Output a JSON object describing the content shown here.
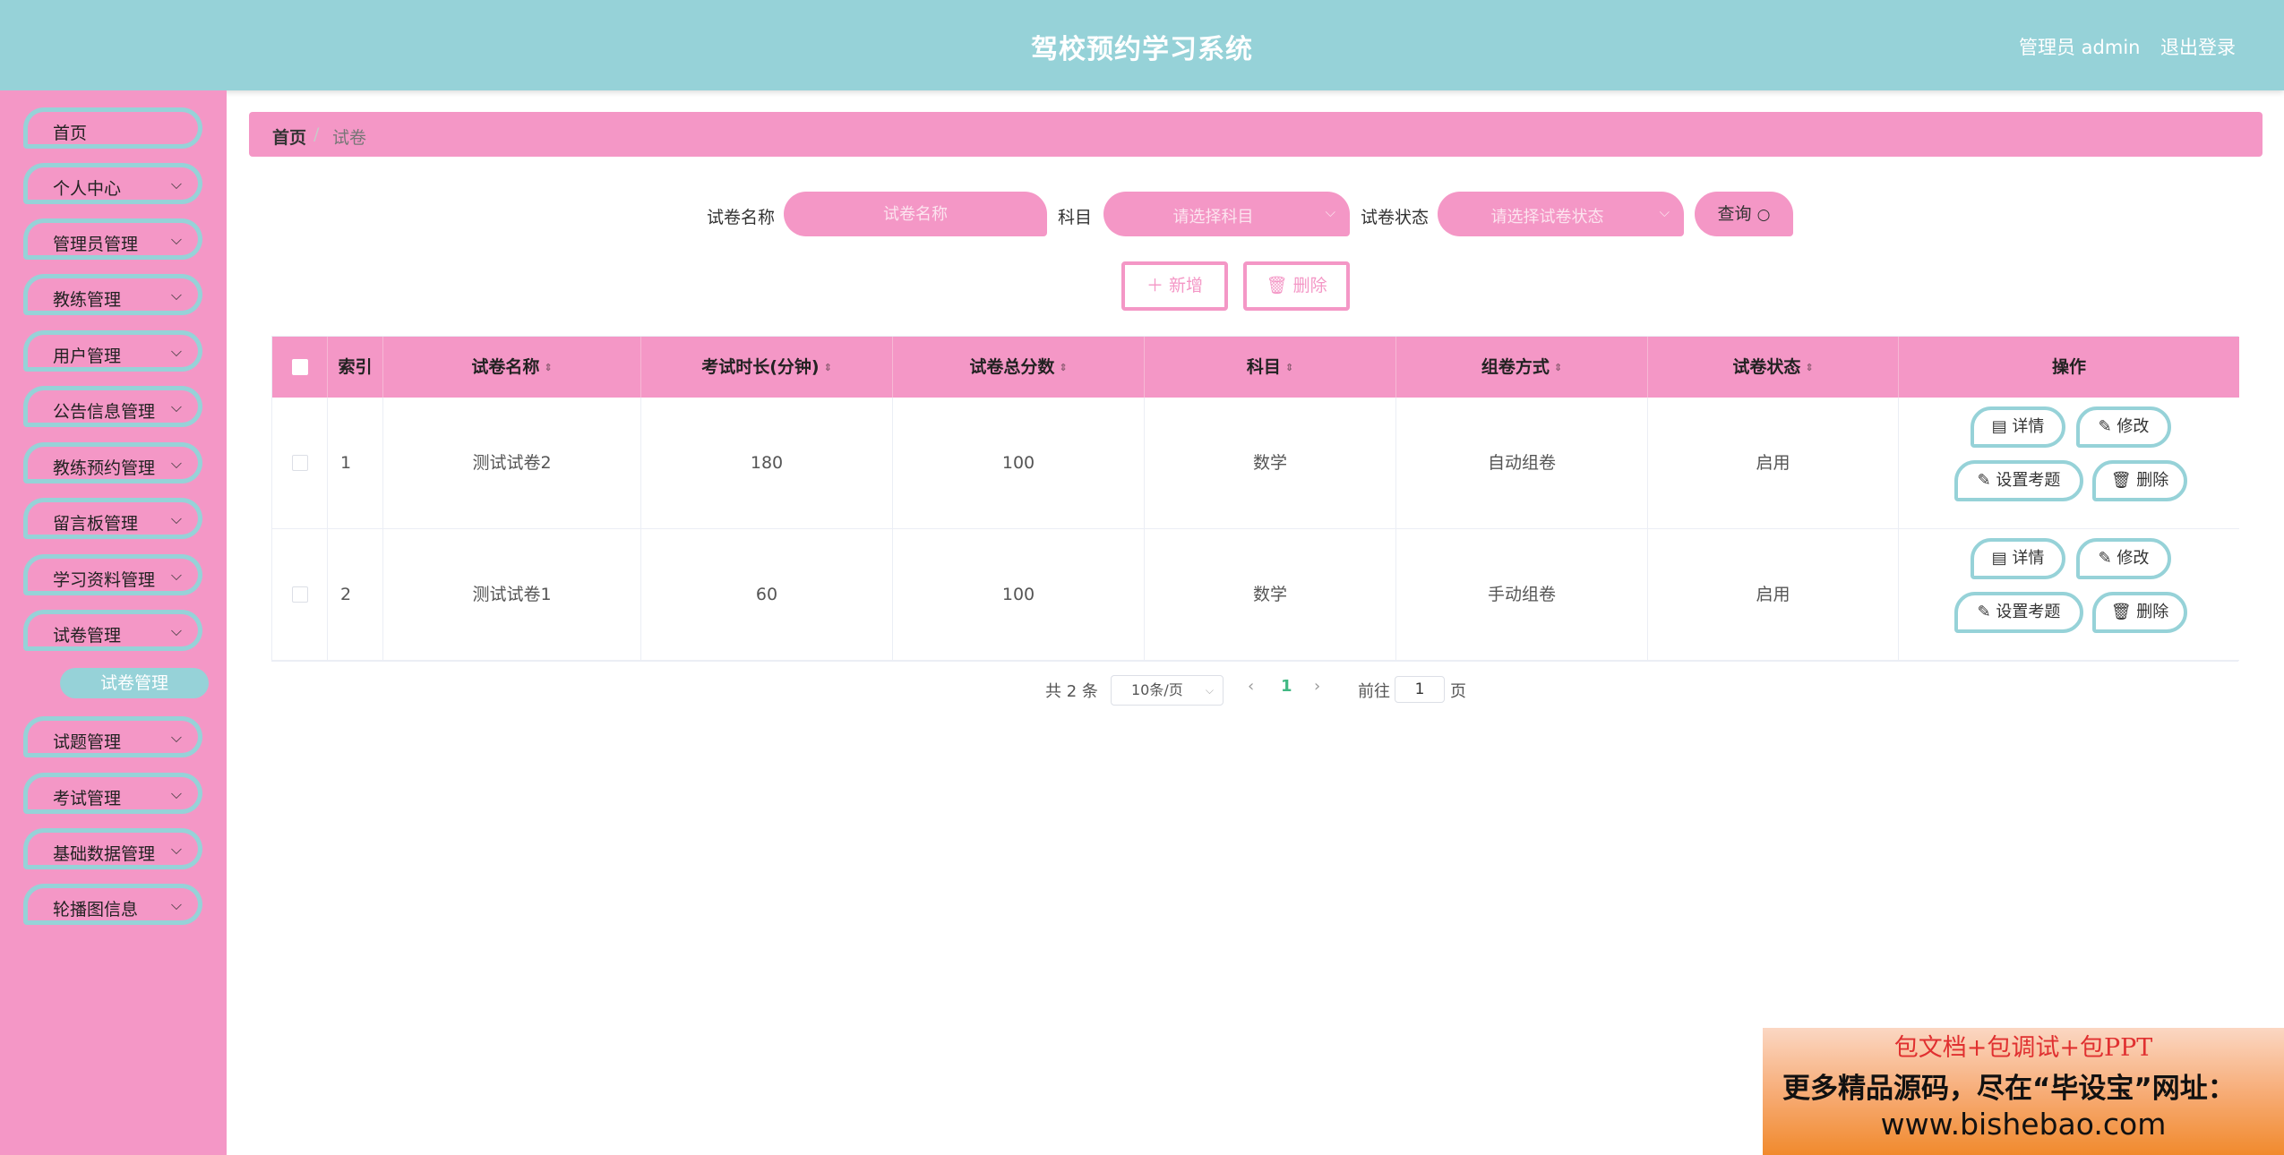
{
  "header": {
    "title": "驾校预约学习系统",
    "user": "管理员 admin",
    "logout": "退出登录"
  },
  "sidebar": {
    "items": [
      {
        "label": "首页",
        "has_children": false
      },
      {
        "label": "个人中心",
        "has_children": true
      },
      {
        "label": "管理员管理",
        "has_children": true
      },
      {
        "label": "教练管理",
        "has_children": true
      },
      {
        "label": "用户管理",
        "has_children": true
      },
      {
        "label": "公告信息管理",
        "has_children": true
      },
      {
        "label": "教练预约管理",
        "has_children": true
      },
      {
        "label": "留言板管理",
        "has_children": true
      },
      {
        "label": "学习资料管理",
        "has_children": true
      },
      {
        "label": "试卷管理",
        "has_children": true
      },
      {
        "label": "试题管理",
        "has_children": true
      },
      {
        "label": "考试管理",
        "has_children": true
      },
      {
        "label": "基础数据管理",
        "has_children": true
      },
      {
        "label": "轮播图信息",
        "has_children": true
      }
    ],
    "active_sub": "试卷管理",
    "chevron": "chevron-down-icon"
  },
  "breadcrumb": {
    "home": "首页",
    "separator": "/",
    "current": "试卷"
  },
  "search": {
    "name_label": "试卷名称",
    "name_placeholder": "试卷名称",
    "subject_label": "科目",
    "subject_placeholder": "请选择科目",
    "status_label": "试卷状态",
    "status_placeholder": "请选择试卷状态",
    "query_label": "查询",
    "query_icon": "search-icon"
  },
  "actions": {
    "add_label": "新增",
    "add_icon": "plus-icon",
    "delete_label": "删除",
    "delete_icon": "trash-icon"
  },
  "table": {
    "columns": [
      "索引",
      "试卷名称",
      "考试时长(分钟)",
      "试卷总分数",
      "科目",
      "组卷方式",
      "试卷状态",
      "操作"
    ],
    "rows": [
      {
        "index": "1",
        "name": "测试试卷2",
        "duration": "180",
        "total": "100",
        "subject": "数学",
        "method": "自动组卷",
        "status": "启用"
      },
      {
        "index": "2",
        "name": "测试试卷1",
        "duration": "60",
        "total": "100",
        "subject": "数学",
        "method": "手动组卷",
        "status": "启用"
      }
    ],
    "ops": {
      "detail": "详情",
      "edit": "修改",
      "set_questions": "设置考题",
      "delete": "删除"
    }
  },
  "pagination": {
    "total_text": "共 2 条",
    "page_size": "10条/页",
    "current_page": "1",
    "goto_prefix": "前往",
    "goto_value": "1",
    "goto_suffix": "页"
  },
  "watermark": {
    "line1": "包文档+包调试+包PPT",
    "line2": "更多精品源码，尽在“毕设宝”网址：",
    "line3": "www.bishebao.com"
  },
  "colors": {
    "header_bg": "#96d2d8",
    "sidebar_bg": "#f497c6",
    "accent_pink": "#f497c6",
    "accent_teal": "#96d2d8",
    "page_active": "#41b883"
  }
}
